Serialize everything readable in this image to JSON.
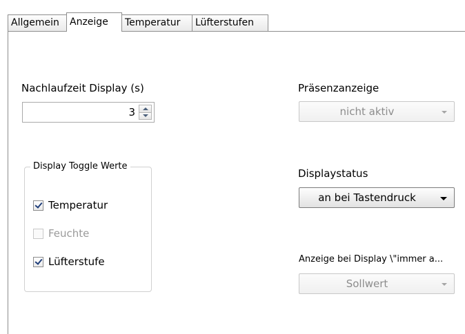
{
  "tabs": [
    {
      "label": "Allgemein",
      "active": false
    },
    {
      "label": "Anzeige",
      "active": true
    },
    {
      "label": "Temperatur",
      "active": false
    },
    {
      "label": "Lüfterstufen",
      "active": false
    }
  ],
  "display_timeout": {
    "label": "Nachlaufzeit Display (s)",
    "value": "3"
  },
  "toggle_group": {
    "title": "Display Toggle Werte",
    "items": [
      {
        "label": "Temperatur",
        "checked": true,
        "enabled": true
      },
      {
        "label": "Feuchte",
        "checked": false,
        "enabled": false
      },
      {
        "label": "Lüfterstufe",
        "checked": true,
        "enabled": true
      }
    ]
  },
  "presence": {
    "label": "Präsenzanzeige",
    "value": "nicht aktiv",
    "enabled": false
  },
  "display_status": {
    "label": "Displaystatus",
    "value": "an bei Tastendruck",
    "enabled": true
  },
  "always_on_display": {
    "label": "Anzeige bei Display \\\"immer a...",
    "value": "Sollwert",
    "enabled": false
  }
}
